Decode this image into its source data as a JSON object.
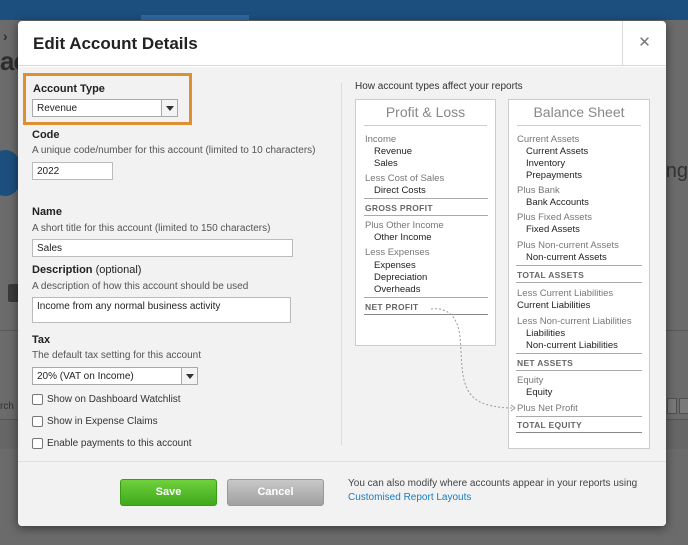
{
  "background": {
    "breadcrumb_chevron": "›",
    "title_fragment": "ac",
    "right_fragment": "ing",
    "left_fragment": "rch"
  },
  "modal": {
    "title": "Edit Account Details",
    "close_glyph": "✕"
  },
  "form": {
    "account_type": {
      "label": "Account Type",
      "value": "Revenue"
    },
    "code": {
      "label": "Code",
      "hint": "A unique code/number for this account (limited to 10 characters)",
      "value": "2022"
    },
    "name": {
      "label": "Name",
      "hint": "A short title for this account (limited to 150 characters)",
      "value": "Sales"
    },
    "description": {
      "label": "Description",
      "optional": "(optional)",
      "hint": "A description of how this account should be used",
      "value": "Income from any normal business activity"
    },
    "tax": {
      "label": "Tax",
      "hint": "The default tax setting for this account",
      "value": "20% (VAT on Income)"
    },
    "checkboxes": [
      {
        "label": "Show on Dashboard Watchlist",
        "checked": false
      },
      {
        "label": "Show in Expense Claims",
        "checked": false
      },
      {
        "label": "Enable payments to this account",
        "checked": false
      }
    ]
  },
  "diagram": {
    "title": "How account types affect your reports",
    "profit_loss": {
      "heading": "Profit & Loss",
      "income": "Income",
      "revenue": "Revenue",
      "sales": "Sales",
      "less_cost_prefix": "Less",
      "less_cost_rest": "Cost of Sales",
      "direct_costs": "Direct Costs",
      "gross_profit": "GROSS PROFIT",
      "plus_other_prefix": "Plus",
      "plus_other_rest": "Other Income",
      "other_income": "Other Income",
      "less_expenses_prefix": "Less",
      "less_expenses_rest": "Expenses",
      "expenses": "Expenses",
      "depreciation": "Depreciation",
      "overheads": "Overheads",
      "net_profit": "NET PROFIT"
    },
    "balance_sheet": {
      "heading": "Balance Sheet",
      "current_assets_group": "Current Assets",
      "current_assets": "Current Assets",
      "inventory": "Inventory",
      "prepayments": "Prepayments",
      "plus_bank_prefix": "Plus",
      "plus_bank_rest": "Bank",
      "bank_accounts": "Bank Accounts",
      "plus_fixed_prefix": "Plus",
      "plus_fixed_rest": "Fixed Assets",
      "fixed_assets": "Fixed Assets",
      "plus_noncurrent_prefix": "Plus",
      "plus_noncurrent_rest": "Non-current Assets",
      "noncurrent_assets": "Non-current Assets",
      "total_assets": "TOTAL ASSETS",
      "less_current_liab_prefix": "Less",
      "less_current_liab_rest": "Current Liabilities",
      "current_liabilities": "Current Liabilities",
      "less_noncurrent_liab_prefix": "Less",
      "less_noncurrent_liab_rest": "Non-current Liabilities",
      "liabilities": "Liabilities",
      "noncurrent_liabilities": "Non-current Liabilities",
      "net_assets": "NET ASSETS",
      "equity_group": "Equity",
      "equity": "Equity",
      "plus_net_profit_prefix": "Plus",
      "plus_net_profit_rest": "Net Profit",
      "total_equity": "TOTAL EQUITY"
    }
  },
  "footer": {
    "save_label": "Save",
    "cancel_label": "Cancel",
    "info_text": "You can also modify where accounts appear in your reports using",
    "link_text": "Customised Report Layouts"
  },
  "colors": {
    "highlight": "#de8f2f",
    "save_green": "#4cbb25",
    "link_blue": "#1a7bbf",
    "header_bar": "#1c4f7e"
  }
}
